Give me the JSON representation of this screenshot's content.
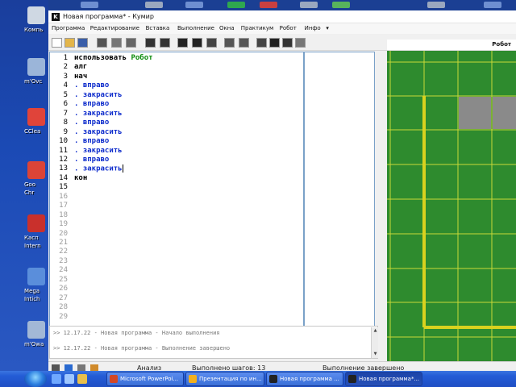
{
  "desktop": {
    "icons": [
      {
        "label": "Компь",
        "icon": "computer-icon",
        "color": "#cfd8e3"
      },
      {
        "label": "m'Ovc",
        "icon": "movie-icon",
        "color": "#9bb5d9"
      },
      {
        "label": "CClea",
        "icon": "ccleaner-icon",
        "color": "#e0443a"
      },
      {
        "label": "Goo\nChr",
        "icon": "chrome-icon",
        "color": "#db4437"
      },
      {
        "label": "Касп\nIntern",
        "icon": "kaspersky-icon",
        "color": "#c9302c"
      },
      {
        "label": "Mega\nIntich",
        "icon": "chart-icon",
        "color": "#5a8edb"
      },
      {
        "label": "m'Owa",
        "icon": "tool-icon",
        "color": "#a2b8d6"
      }
    ]
  },
  "window": {
    "title": "Новая программа* - Кумир",
    "app_icon_letter": "K"
  },
  "menu": [
    "Программа",
    "Редактирование",
    "Вставка",
    "Выполнение",
    "Окна",
    "Практикум",
    "Робот",
    "Инфо"
  ],
  "menu_more": "▾",
  "toolbar": {
    "icons": [
      "new-file-icon",
      "open-folder-icon",
      "save-icon",
      "cut-icon",
      "copy-icon",
      "paste-icon",
      "undo-icon",
      "redo-icon",
      "run-icon",
      "step-run-icon",
      "stop-icon",
      "step-into-icon",
      "step-over-icon",
      "robot-window-icon",
      "table-icon",
      "grid-icon",
      "more-icon"
    ]
  },
  "robot_panel": {
    "title": "Робот",
    "colors": {
      "field": "#2e8b2e",
      "grid_line": "#c8d838",
      "wall": "#d9d21e",
      "painted": "#8a8a8a"
    },
    "painted_cells": 2
  },
  "editor": {
    "lines": [
      {
        "num": "1",
        "text": "использовать",
        "extra": " Робот"
      },
      {
        "num": "2",
        "text": "алг"
      },
      {
        "num": "3",
        "text": "нач"
      },
      {
        "num": "4",
        "text": ". вправо"
      },
      {
        "num": "5",
        "text": ". закрасить"
      },
      {
        "num": "6",
        "text": ". вправо"
      },
      {
        "num": "7",
        "text": ". закрасить"
      },
      {
        "num": "8",
        "text": ". вправо"
      },
      {
        "num": "9",
        "text": ". закрасить"
      },
      {
        "num": "10",
        "text": ". вправо"
      },
      {
        "num": "11",
        "text": ". закрасить"
      },
      {
        "num": "12",
        "text": ". вправо"
      },
      {
        "num": "13",
        "text": ". закрасить"
      },
      {
        "num": "14",
        "text": "кон"
      },
      {
        "num": "15",
        "text": ""
      },
      {
        "num": "16",
        "text": ""
      },
      {
        "num": "17",
        "text": ""
      },
      {
        "num": "18",
        "text": ""
      },
      {
        "num": "19",
        "text": ""
      },
      {
        "num": "20",
        "text": ""
      },
      {
        "num": "21",
        "text": ""
      },
      {
        "num": "22",
        "text": ""
      },
      {
        "num": "23",
        "text": ""
      },
      {
        "num": "24",
        "text": ""
      },
      {
        "num": "25",
        "text": ""
      },
      {
        "num": "26",
        "text": ""
      },
      {
        "num": "27",
        "text": ""
      },
      {
        "num": "28",
        "text": ""
      },
      {
        "num": "29",
        "text": ""
      }
    ]
  },
  "console": {
    "lines": [
      ">> 12.17.22 - Новая программа - Начало выполнения",
      ">> 12.17.22 - Новая программа - Выполнение завершено"
    ]
  },
  "statusbar": {
    "mode": "Анализ",
    "steps": "Выполнено шагов: 13",
    "state": "Выполнение завершено"
  },
  "taskbar": {
    "tasks": [
      {
        "label": "Microsoft PowerPoi...",
        "icon": "powerpoint-icon",
        "color": "#d24726",
        "active": false
      },
      {
        "label": "Презентация по ин...",
        "icon": "chrome-icon",
        "color": "#f2b01e",
        "active": false
      },
      {
        "label": "Новая программа ...",
        "icon": "kumir-icon",
        "color": "#222222",
        "active": false
      },
      {
        "label": "Новая программа*...",
        "icon": "kumir-icon",
        "color": "#222222",
        "active": true
      }
    ]
  }
}
